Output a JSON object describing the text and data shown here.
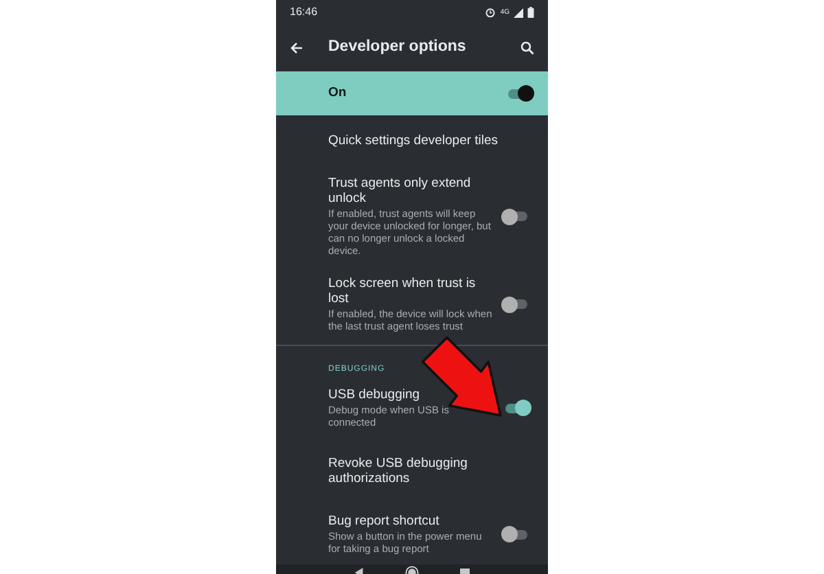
{
  "status_bar": {
    "time": "16:46",
    "network": "4G"
  },
  "toolbar": {
    "title": "Developer options"
  },
  "master_switch": {
    "label": "On",
    "on": true
  },
  "items": [
    {
      "kind": "plain",
      "title": "Quick settings developer tiles"
    },
    {
      "kind": "toggle",
      "title": "Trust agents only extend unlock",
      "summary": "If enabled, trust agents will keep your device unlocked for longer, but can no longer unlock a locked device.",
      "on": false
    },
    {
      "kind": "toggle",
      "title": "Lock screen when trust is lost",
      "summary": "If enabled, the device will lock when the last trust agent loses trust",
      "on": false
    },
    {
      "kind": "header",
      "title": "DEBUGGING"
    },
    {
      "kind": "toggle",
      "title": "USB debugging",
      "summary": "Debug mode when USB is connected",
      "on": true
    },
    {
      "kind": "plain",
      "title": "Revoke USB debugging authorizations"
    },
    {
      "kind": "toggle",
      "title": "Bug report shortcut",
      "summary": "Show a button in the power menu for taking a bug report",
      "on": false
    }
  ]
}
